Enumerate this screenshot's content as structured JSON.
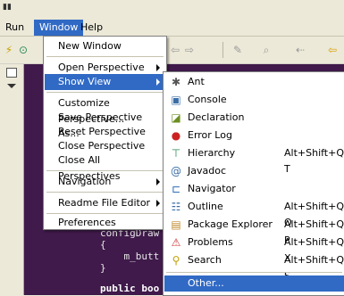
{
  "menubar": {
    "items": [
      "Run",
      "Window",
      "Help"
    ]
  },
  "toolbar": {
    "icons": [
      "run-icon",
      "open-perspective-icon",
      "nav-back-icon",
      "nav-forward-icon",
      "edit-icon",
      "search-icon",
      "back-arrow-icon",
      "forward-arrow-icon"
    ]
  },
  "editor": {
    "lines": [
      "configDraw",
      "{",
      "    m_butt",
      "}",
      "public boo"
    ]
  },
  "window_menu": {
    "items": [
      {
        "label": "New Window"
      },
      {
        "label": "Open Perspective",
        "submenu": true
      },
      {
        "label": "Show View",
        "submenu": true,
        "highlighted": true
      },
      {
        "label": "Customize Perspective..."
      },
      {
        "label": "Save Perspective As..."
      },
      {
        "label": "Reset Perspective"
      },
      {
        "label": "Close Perspective"
      },
      {
        "label": "Close All Perspectives"
      },
      {
        "label": "Navigation",
        "submenu": true
      },
      {
        "label": "Readme File Editor",
        "submenu": true
      },
      {
        "label": "Preferences"
      }
    ]
  },
  "show_view_menu": {
    "items": [
      {
        "label": "Ant",
        "icon": "ant-icon",
        "shortcut": ""
      },
      {
        "label": "Console",
        "icon": "console-icon",
        "shortcut": ""
      },
      {
        "label": "Declaration",
        "icon": "declaration-icon",
        "shortcut": ""
      },
      {
        "label": "Error Log",
        "icon": "error-log-icon",
        "shortcut": ""
      },
      {
        "label": "Hierarchy",
        "icon": "hierarchy-icon",
        "shortcut": "Alt+Shift+Q, T"
      },
      {
        "label": "Javadoc",
        "icon": "javadoc-icon",
        "shortcut": ""
      },
      {
        "label": "Navigator",
        "icon": "navigator-icon",
        "shortcut": ""
      },
      {
        "label": "Outline",
        "icon": "outline-icon",
        "shortcut": "Alt+Shift+Q, O"
      },
      {
        "label": "Package Explorer",
        "icon": "package-explorer-icon",
        "shortcut": "Alt+Shift+Q, P"
      },
      {
        "label": "Problems",
        "icon": "problems-icon",
        "shortcut": "Alt+Shift+Q, X"
      },
      {
        "label": "Search",
        "icon": "search-icon",
        "shortcut": "Alt+Shift+Q, S"
      },
      {
        "label": "Other...",
        "icon": "",
        "shortcut": "",
        "highlighted": true
      }
    ]
  },
  "colors": {
    "highlight": "#316ac5",
    "menu_bg": "#ffffff",
    "chrome_bg": "#ece9d8",
    "editor_bg": "#3f1a4a"
  }
}
